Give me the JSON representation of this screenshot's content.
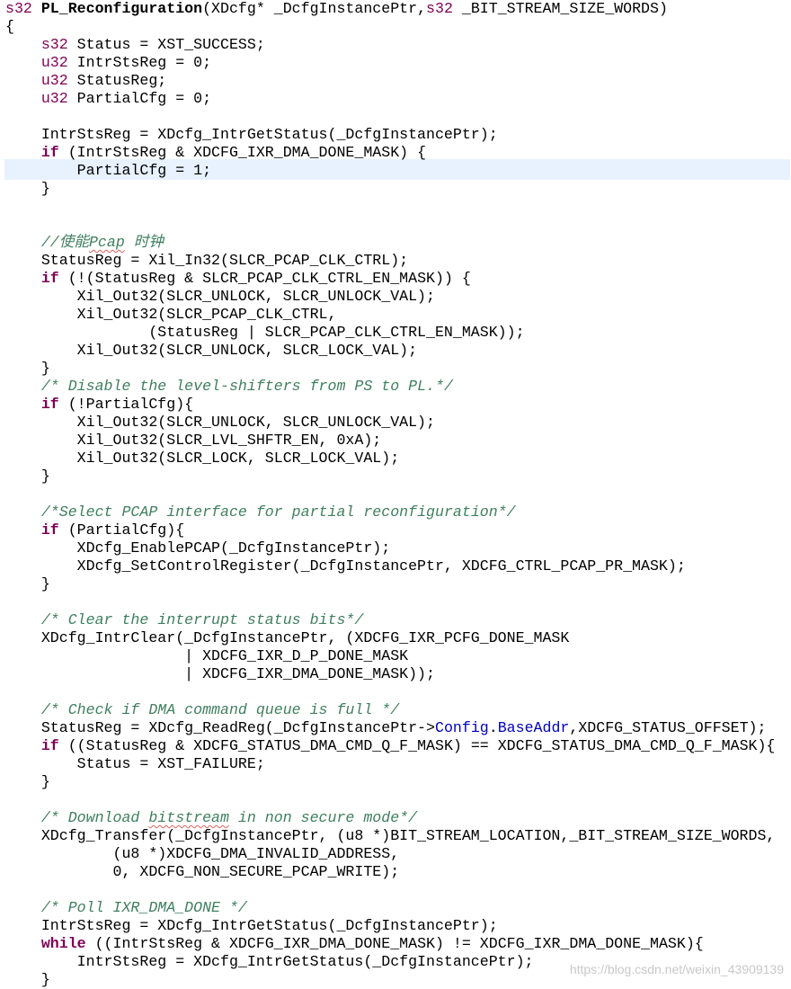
{
  "editor": {
    "lines": [
      [
        {
          "t": "s32",
          "c": "ty"
        },
        {
          "t": " "
        },
        {
          "t": "PL_Reconfiguration",
          "c": "fn"
        },
        {
          "t": "(XDcfg* _DcfgInstancePtr,"
        },
        {
          "t": "s32",
          "c": "ty"
        },
        {
          "t": " _BIT_STREAM_SIZE_WORDS)"
        }
      ],
      [
        {
          "t": "{"
        }
      ],
      [
        {
          "t": "    "
        },
        {
          "t": "s32",
          "c": "ty"
        },
        {
          "t": " Status = XST_SUCCESS;"
        }
      ],
      [
        {
          "t": "    "
        },
        {
          "t": "u32",
          "c": "ty"
        },
        {
          "t": " IntrStsReg = 0;"
        }
      ],
      [
        {
          "t": "    "
        },
        {
          "t": "u32",
          "c": "ty"
        },
        {
          "t": " StatusReg;"
        }
      ],
      [
        {
          "t": "    "
        },
        {
          "t": "u32",
          "c": "ty"
        },
        {
          "t": " PartialCfg = 0;"
        }
      ],
      [
        {
          "t": ""
        }
      ],
      [
        {
          "t": "    IntrStsReg = XDcfg_IntrGetStatus(_DcfgInstancePtr);"
        }
      ],
      [
        {
          "t": "    "
        },
        {
          "t": "if",
          "c": "kw"
        },
        {
          "t": " (IntrStsReg & XDCFG_IXR_DMA_DONE_MASK) {"
        }
      ],
      [
        {
          "t": "        PartialCfg = 1;"
        }
      ],
      [
        {
          "t": "    }"
        }
      ],
      [
        {
          "t": ""
        }
      ],
      [
        {
          "t": ""
        }
      ],
      [
        {
          "t": "    "
        },
        {
          "t": "//使能",
          "c": "cm"
        },
        {
          "t": "Pcap",
          "c": "cm sq"
        },
        {
          "t": " 时钟",
          "c": "cm"
        }
      ],
      [
        {
          "t": "    StatusReg = Xil_In32(SLCR_PCAP_CLK_CTRL);"
        }
      ],
      [
        {
          "t": "    "
        },
        {
          "t": "if",
          "c": "kw"
        },
        {
          "t": " (!(StatusReg & SLCR_PCAP_CLK_CTRL_EN_MASK)) {"
        }
      ],
      [
        {
          "t": "        Xil_Out32(SLCR_UNLOCK, SLCR_UNLOCK_VAL);"
        }
      ],
      [
        {
          "t": "        Xil_Out32(SLCR_PCAP_CLK_CTRL,"
        }
      ],
      [
        {
          "t": "                (StatusReg | SLCR_PCAP_CLK_CTRL_EN_MASK));"
        }
      ],
      [
        {
          "t": "        Xil_Out32(SLCR_UNLOCK, SLCR_LOCK_VAL);"
        }
      ],
      [
        {
          "t": "    }"
        }
      ],
      [
        {
          "t": "    "
        },
        {
          "t": "/* Disable the level-shifters from PS to PL.*/",
          "c": "cm"
        }
      ],
      [
        {
          "t": "    "
        },
        {
          "t": "if",
          "c": "kw"
        },
        {
          "t": " (!PartialCfg){"
        }
      ],
      [
        {
          "t": "        Xil_Out32(SLCR_UNLOCK, SLCR_UNLOCK_VAL);"
        }
      ],
      [
        {
          "t": "        Xil_Out32(SLCR_LVL_SHFTR_EN, 0xA);"
        }
      ],
      [
        {
          "t": "        Xil_Out32(SLCR_LOCK, SLCR_LOCK_VAL);"
        }
      ],
      [
        {
          "t": "    }"
        }
      ],
      [
        {
          "t": ""
        }
      ],
      [
        {
          "t": "    "
        },
        {
          "t": "/*Select PCAP interface for partial reconfiguration*/",
          "c": "cm"
        }
      ],
      [
        {
          "t": "    "
        },
        {
          "t": "if",
          "c": "kw"
        },
        {
          "t": " (PartialCfg){"
        }
      ],
      [
        {
          "t": "        XDcfg_EnablePCAP(_DcfgInstancePtr);"
        }
      ],
      [
        {
          "t": "        XDcfg_SetControlRegister(_DcfgInstancePtr, XDCFG_CTRL_PCAP_PR_MASK);"
        }
      ],
      [
        {
          "t": "    }"
        }
      ],
      [
        {
          "t": ""
        }
      ],
      [
        {
          "t": "    "
        },
        {
          "t": "/* Clear the interrupt status bits*/",
          "c": "cm"
        }
      ],
      [
        {
          "t": "    XDcfg_IntrClear(_DcfgInstancePtr, (XDCFG_IXR_PCFG_DONE_MASK"
        }
      ],
      [
        {
          "t": "                    | XDCFG_IXR_D_P_DONE_MASK"
        }
      ],
      [
        {
          "t": "                    | XDCFG_IXR_DMA_DONE_MASK));"
        }
      ],
      [
        {
          "t": ""
        }
      ],
      [
        {
          "t": "    "
        },
        {
          "t": "/* Check if DMA command queue is full */",
          "c": "cm"
        }
      ],
      [
        {
          "t": "    StatusReg = XDcfg_ReadReg(_DcfgInstancePtr->"
        },
        {
          "t": "Config",
          "c": "fd"
        },
        {
          "t": "."
        },
        {
          "t": "BaseAddr",
          "c": "fd"
        },
        {
          "t": ",XDCFG_STATUS_OFFSET);"
        }
      ],
      [
        {
          "t": "    "
        },
        {
          "t": "if",
          "c": "kw"
        },
        {
          "t": " ((StatusReg & XDCFG_STATUS_DMA_CMD_Q_F_MASK) == XDCFG_STATUS_DMA_CMD_Q_F_MASK){"
        }
      ],
      [
        {
          "t": "        Status = XST_FAILURE;"
        }
      ],
      [
        {
          "t": "    }"
        }
      ],
      [
        {
          "t": ""
        }
      ],
      [
        {
          "t": "    "
        },
        {
          "t": "/* Download ",
          "c": "cm"
        },
        {
          "t": "bitstream",
          "c": "cm sq"
        },
        {
          "t": " in non secure mode*/",
          "c": "cm"
        }
      ],
      [
        {
          "t": "    XDcfg_Transfer(_DcfgInstancePtr, (u8 *)BIT_STREAM_LOCATION,_BIT_STREAM_SIZE_WORDS,"
        }
      ],
      [
        {
          "t": "            (u8 *)XDCFG_DMA_INVALID_ADDRESS,"
        }
      ],
      [
        {
          "t": "            0, XDCFG_NON_SECURE_PCAP_WRITE);"
        }
      ],
      [
        {
          "t": ""
        }
      ],
      [
        {
          "t": "    "
        },
        {
          "t": "/* Poll IXR_DMA_DONE */",
          "c": "cm"
        }
      ],
      [
        {
          "t": "    IntrStsReg = XDcfg_IntrGetStatus(_DcfgInstancePtr);"
        }
      ],
      [
        {
          "t": "    "
        },
        {
          "t": "while",
          "c": "kw"
        },
        {
          "t": " ((IntrStsReg & XDCFG_IXR_DMA_DONE_MASK) != XDCFG_IXR_DMA_DONE_MASK){"
        }
      ],
      [
        {
          "t": "        IntrStsReg = XDcfg_IntrGetStatus(_DcfgInstancePtr);"
        }
      ],
      [
        {
          "t": "    }"
        }
      ]
    ]
  },
  "watermark": "https://blog.csdn.net/weixin_43909139"
}
